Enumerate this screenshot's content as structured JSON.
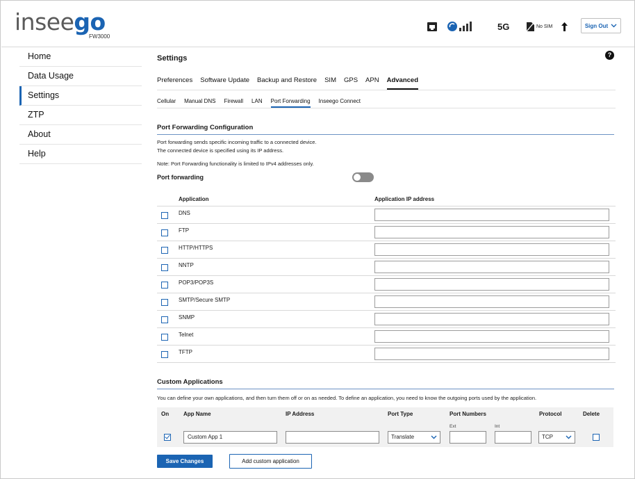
{
  "header": {
    "logo_prefix": "insee",
    "logo_suffix": "go",
    "model": "FW3000",
    "network": "5G",
    "sim_status": "No SIM",
    "sign_out": "Sign Out"
  },
  "colors": {
    "accent": "#1b64b3",
    "toggle_off": "#8a8a8a",
    "table_bg": "#f1f1f1"
  },
  "sidebar": {
    "items": [
      {
        "label": "Home"
      },
      {
        "label": "Data Usage"
      },
      {
        "label": "Settings"
      },
      {
        "label": "ZTP"
      },
      {
        "label": "About"
      },
      {
        "label": "Help"
      }
    ]
  },
  "main": {
    "title": "Settings",
    "help": "?",
    "tabs": [
      {
        "label": "Preferences"
      },
      {
        "label": "Software Update"
      },
      {
        "label": "Backup and Restore"
      },
      {
        "label": "SIM"
      },
      {
        "label": "GPS"
      },
      {
        "label": "APN"
      },
      {
        "label": "Advanced"
      }
    ],
    "subtabs": [
      {
        "label": "Cellular"
      },
      {
        "label": "Manual DNS"
      },
      {
        "label": "Firewall"
      },
      {
        "label": "LAN"
      },
      {
        "label": "Port Forwarding"
      },
      {
        "label": "Inseego Connect"
      }
    ]
  },
  "port_forwarding": {
    "section_title": "Port Forwarding Configuration",
    "desc_line1": "Port forwarding sends specific incoming traffic to a connected device.",
    "desc_line2": "The connected device is specified using its IP address.",
    "note": "Note: Port Forwarding functionality is limited to IPv4 addresses only.",
    "toggle_label": "Port forwarding",
    "toggle_on": false,
    "col_application": "Application",
    "col_ip": "Application IP address",
    "applications": [
      {
        "name": "DNS"
      },
      {
        "name": "FTP"
      },
      {
        "name": "HTTP/HTTPS"
      },
      {
        "name": "NNTP"
      },
      {
        "name": "POP3/POP3S"
      },
      {
        "name": "SMTP/Secure SMTP"
      },
      {
        "name": "SNMP"
      },
      {
        "name": "Telnet"
      },
      {
        "name": "TFTP"
      }
    ]
  },
  "custom": {
    "section_title": "Custom Applications",
    "desc": "You can define your own applications, and then turn them off or on as needed. To define an application, you need to know the outgoing ports used by the application.",
    "headers": {
      "on": "On",
      "app_name": "App Name",
      "ip": "IP Address",
      "port_type": "Port Type",
      "port_numbers": "Port Numbers",
      "ext": "Ext",
      "int": "Int",
      "protocol": "Protocol",
      "delete": "Delete"
    },
    "row": {
      "on": true,
      "app_name": "Custom App 1",
      "ip": "",
      "port_type": "Translate",
      "ext": "",
      "int": "",
      "protocol": "TCP",
      "delete": false
    }
  },
  "buttons": {
    "save": "Save Changes",
    "add": "Add custom application"
  }
}
